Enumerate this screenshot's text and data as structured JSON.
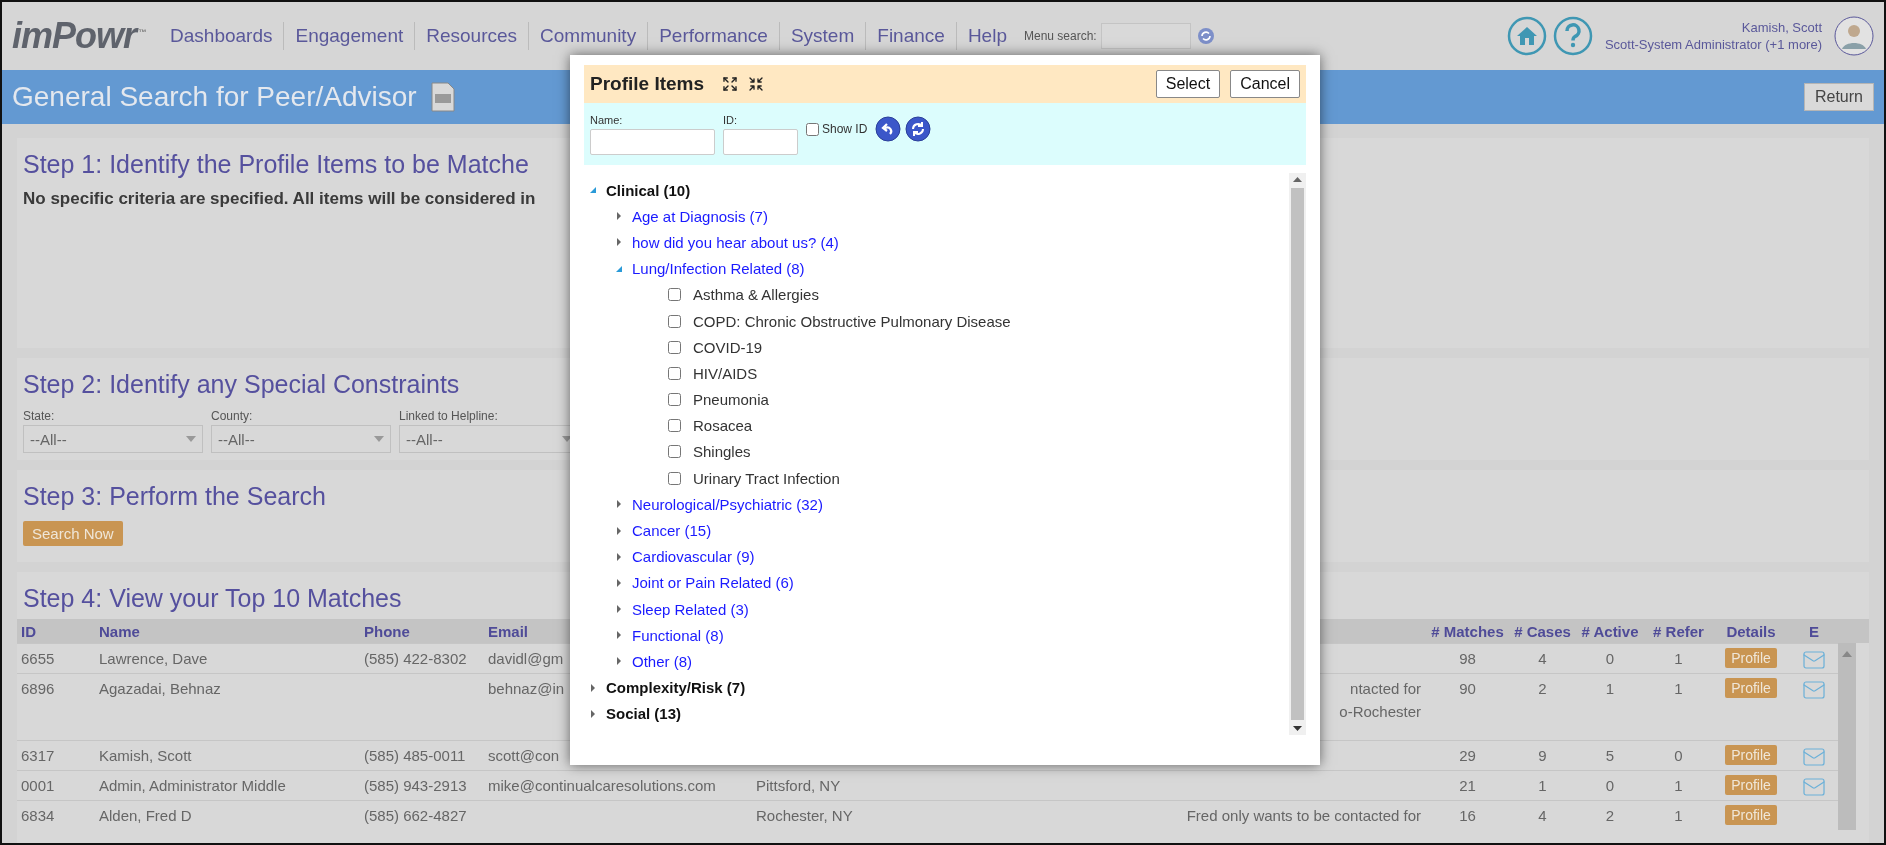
{
  "header": {
    "logo": "imPowr",
    "logo_mark": "™",
    "nav": [
      "Dashboards",
      "Engagement",
      "Resources",
      "Community",
      "Performance",
      "System",
      "Finance",
      "Help"
    ],
    "menu_search_label": "Menu search:",
    "user": {
      "name": "Kamish, Scott",
      "role": "Scott-System Administrator (+1 more)"
    }
  },
  "page_title": "General Search for Peer/Advisor",
  "return_button": "Return",
  "step1": {
    "title": "Step 1: Identify the Profile Items to be Matche",
    "message": "No specific criteria are specified. All items will be considered in"
  },
  "step2": {
    "title": "Step 2: Identify any Special Constraints",
    "filters": [
      {
        "label": "State:",
        "value": "--All--"
      },
      {
        "label": "County:",
        "value": "--All--"
      },
      {
        "label": "Linked to Helpline:",
        "value": "--All--"
      }
    ]
  },
  "step3": {
    "title": "Step 3: Perform the Search",
    "button": "Search Now"
  },
  "step4": {
    "title": "Step 4: View your Top 10 Matches"
  },
  "table": {
    "headers": {
      "id": "ID",
      "name": "Name",
      "phone": "Phone",
      "email": "Email",
      "matches": "# Matches",
      "cases": "# Cases",
      "active": "# Active",
      "refer": "# Refer",
      "details": "Details",
      "e": "E"
    },
    "rows": [
      {
        "id": "6655",
        "name": "Lawrence, Dave",
        "phone": "(585) 422-8302",
        "email": "davidl@gm",
        "matches": "98",
        "cases": "4",
        "active": "0",
        "refer": "1",
        "details": "Profile",
        "email_icon": true
      },
      {
        "id": "6896",
        "name": "Agazadai, Behnaz",
        "email": "behnaz@in",
        "column_7": [
          "ntacted for",
          "o-Rochester"
        ],
        "matches": "90",
        "cases": "2",
        "active": "1",
        "refer": "1",
        "details": "Profile",
        "email_icon": true
      },
      {
        "id": "6317",
        "name": "Kamish, Scott",
        "phone": "(585) 485-0011",
        "email": "scott@con",
        "matches": "29",
        "cases": "9",
        "active": "5",
        "refer": "0",
        "details": "Profile",
        "email_icon": true
      },
      {
        "id": "0001",
        "name": "Admin, Administrator Middle",
        "phone": "(585) 943-2913",
        "email": "mike@continualcaresolutions.com",
        "column_5": "Pittsford, NY",
        "matches": "21",
        "cases": "1",
        "active": "0",
        "refer": "1",
        "details": "Profile",
        "email_icon": true
      },
      {
        "id": "6834",
        "name": "Alden, Fred D",
        "phone": "(585) 662-4827",
        "column_5": "Rochester, NY",
        "column_7": [
          "Fred only wants to be contacted for"
        ],
        "matches": "16",
        "cases": "4",
        "active": "2",
        "refer": "1",
        "details": "Profile",
        "email_icon": false
      }
    ]
  },
  "modal": {
    "title": "Profile Items",
    "buttons": [
      "Select",
      "Cancel"
    ],
    "name_label": "Name:",
    "id_label": "ID:",
    "show_id": {
      "label": "Show ID",
      "checked": false
    },
    "tree": [
      {
        "kind": "category",
        "label": "Clinical (10)",
        "expanded": true,
        "children": [
          {
            "kind": "group",
            "label": "Age at Diagnosis (7)",
            "expanded": false
          },
          {
            "kind": "group",
            "label": "how did you hear about us? (4)",
            "expanded": false
          },
          {
            "kind": "group",
            "label": "Lung/Infection Related (8)",
            "expanded": true,
            "children": [
              {
                "kind": "option",
                "label": "Asthma & Allergies",
                "checked": false
              },
              {
                "kind": "option",
                "label": "COPD: Chronic Obstructive Pulmonary Disease",
                "checked": false
              },
              {
                "kind": "option",
                "label": "COVID-19",
                "checked": false
              },
              {
                "kind": "option",
                "label": "HIV/AIDS",
                "checked": false
              },
              {
                "kind": "option",
                "label": "Pneumonia",
                "checked": false
              },
              {
                "kind": "option",
                "label": "Rosacea",
                "checked": false
              },
              {
                "kind": "option",
                "label": "Shingles",
                "checked": false
              },
              {
                "kind": "option",
                "label": "Urinary Tract Infection",
                "checked": false
              }
            ]
          },
          {
            "kind": "group",
            "label": "Neurological/Psychiatric (32)",
            "expanded": false
          },
          {
            "kind": "group",
            "label": "Cancer (15)",
            "expanded": false
          },
          {
            "kind": "group",
            "label": "Cardiovascular (9)",
            "expanded": false
          },
          {
            "kind": "group",
            "label": "Joint or Pain Related (6)",
            "expanded": false
          },
          {
            "kind": "group",
            "label": "Sleep Related (3)",
            "expanded": false
          },
          {
            "kind": "group",
            "label": "Functional (8)",
            "expanded": false
          },
          {
            "kind": "group",
            "label": "Other (8)",
            "expanded": false
          }
        ]
      },
      {
        "kind": "category",
        "label": "Complexity/Risk (7)",
        "expanded": false
      },
      {
        "kind": "category",
        "label": "Social (13)",
        "expanded": false
      }
    ]
  }
}
